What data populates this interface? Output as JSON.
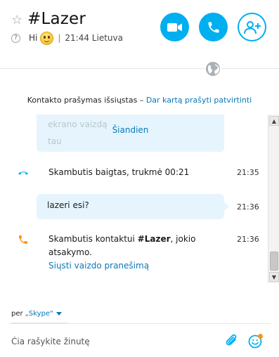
{
  "header": {
    "contact_name": "#Lazer",
    "mood": "Hi",
    "separator": "|",
    "local_time": "21:44 Lietuva",
    "icons": {
      "favorite": "star-outline-icon",
      "help": "question-icon",
      "mood_emoticon": "smiley-icon",
      "video_call": "video-camera-icon",
      "audio_call": "phone-icon",
      "add_people": "add-person-icon",
      "language": "globe-icon"
    }
  },
  "request_note": {
    "text": "Kontakto prašymas išsiųstas – ",
    "link": "Dar kartą prašyti patvirtinti"
  },
  "chat": {
    "faded_text_line1": "ekrano vaizdą",
    "faded_text_line2": "tau",
    "date_label": "Šiandien",
    "messages": [
      {
        "type": "call-ended",
        "icon": "phone-hangup-icon",
        "text": "Skambutis baigtas, trukmė 00:21",
        "time": "21:35"
      },
      {
        "type": "text",
        "text": "lazeri esi?",
        "time": "21:36"
      },
      {
        "type": "call-unanswered",
        "icon": "phone-outgoing-icon",
        "text_prefix": "Skambutis kontaktui ",
        "text_name": "#Lazer",
        "text_suffix": ", jokio",
        "text_line2": "atsakymo.",
        "link": "Siųsti vaizdo pranešimą",
        "time": "21:36"
      }
    ]
  },
  "footer": {
    "via_label": "per",
    "via_service": "„Skype\"",
    "compose_placeholder": "Čia rašykite žinutę",
    "icons": {
      "attach": "paperclip-icon",
      "emoticons": "emoticon-icon"
    }
  },
  "colors": {
    "accent": "#00aff0",
    "link": "#0a78b8",
    "bubble": "#e6f5fd",
    "call_ended_icon": "#00aff0",
    "call_unanswered_icon": "#f7941d"
  }
}
